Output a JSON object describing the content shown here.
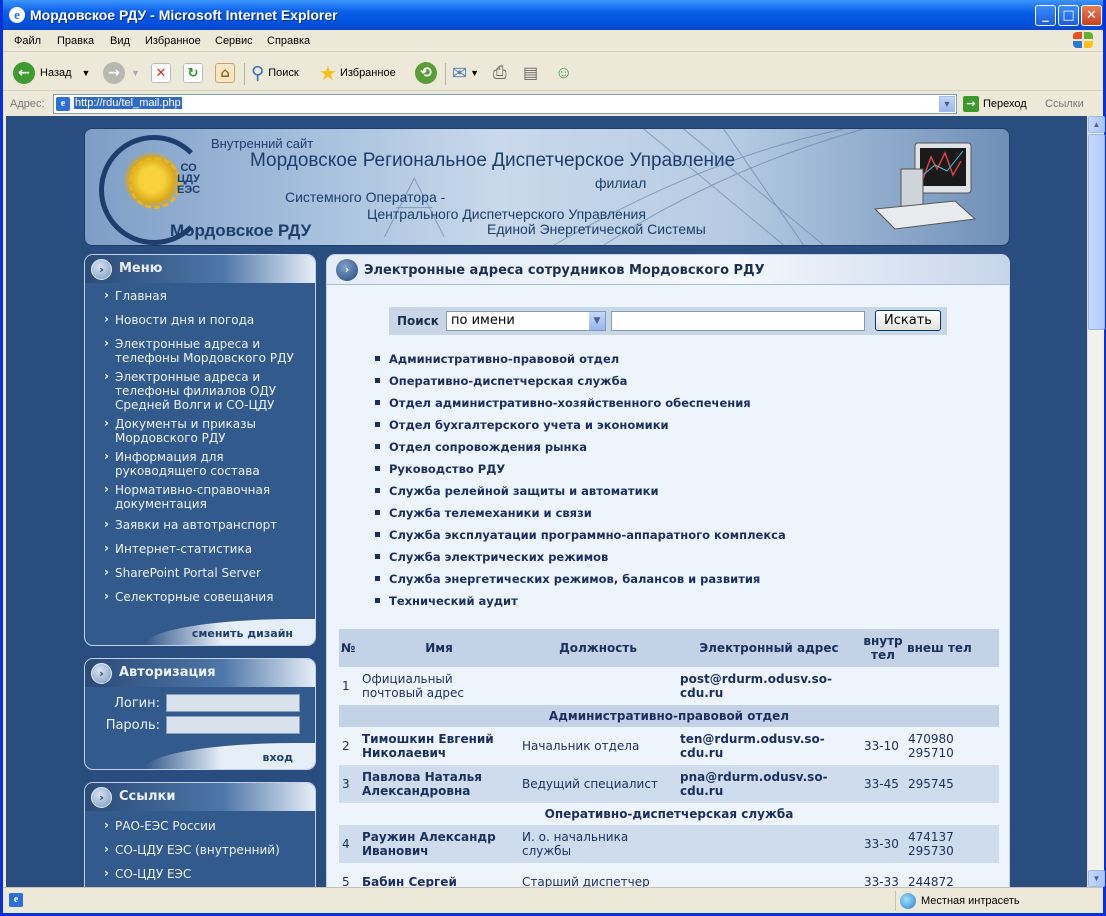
{
  "window": {
    "title": "Мордовское РДУ - Microsoft Internet Explorer"
  },
  "menu": [
    "Файл",
    "Правка",
    "Вид",
    "Избранное",
    "Сервис",
    "Справка"
  ],
  "toolbar": {
    "back": "Назад",
    "search": "Поиск",
    "favorites": "Избранное"
  },
  "address": {
    "label": "Адрес:",
    "url": "http://rdu/tel_mail.php",
    "go": "Переход",
    "links": "Ссылки"
  },
  "status": {
    "zone": "Местная интрасеть"
  },
  "banner": {
    "internal": "Внутренний сайт",
    "org": "Мордовское Региональное Диспетчерское Управление",
    "branch": "филиал",
    "line1": "Системного Оператора -",
    "line2": "Центрального Диспетчерского Управления",
    "line3": "Единой Энергетической Системы",
    "short": "Мордовское РДУ",
    "logo_text": [
      "СО",
      "ЦДУ",
      "ЕЭС"
    ]
  },
  "sidebar": {
    "menu_title": "Меню",
    "menu_items": [
      "Главная",
      "Новости дня и погода",
      "Электронные адреса и телефоны Мордовского РДУ",
      "Электронные адреса и телефоны филиалов ОДУ Средней Волги и СО-ЦДУ",
      "Документы и приказы Мордовского РДУ",
      "Информация для руководящего состава",
      "Нормативно-справочная документация",
      "Заявки на автотранспорт",
      "Интернет-статистика",
      "SharePoint Portal Server",
      "Селекторные совещания"
    ],
    "change_design": "сменить дизайн",
    "auth_title": "Авторизация",
    "login_label": "Логин:",
    "password_label": "Пароль:",
    "login_link": "вход",
    "links_title": "Ссылки",
    "links": [
      "РАО-ЕЭС России",
      "СО-ЦДУ ЕЭС (внутренний)",
      "СО-ЦДУ ЕЭС"
    ]
  },
  "content": {
    "title": "Электронные адреса сотрудников Мордовского РДУ",
    "search_label": "Поиск",
    "search_mode": "по имени",
    "search_button": "Искать",
    "departments": [
      "Административно-правовой отдел",
      "Оперативно-диспетчерская служба",
      "Отдел административно-хозяйственного обеспечения",
      "Отдел бухгалтерского учета и экономики",
      "Отдел сопровождения рынка",
      "Руководство РДУ",
      "Служба релейной защиты и автоматики",
      "Служба телемеханики и связи",
      "Служба эксплуатации программно-аппаратного комплекса",
      "Служба электрических режимов",
      "Служба энергетических режимов, балансов и развития",
      "Технический аудит"
    ],
    "table": {
      "headers": [
        "№",
        "Имя",
        "Должность",
        "Электронный адрес",
        "внутр тел",
        "внеш тел"
      ],
      "row1": {
        "n": "1",
        "name": "Официальный почтовый адрес",
        "pos": "",
        "email": "post@rdurm.odusv.so-cdu.ru",
        "in": "",
        "out": ""
      },
      "group1": "Административно-правовой отдел",
      "row2": {
        "n": "2",
        "name": "Тимошкин Евгений Николаевич",
        "pos": "Начальник отдела",
        "email": "ten@rdurm.odusv.so-cdu.ru",
        "in": "33-10",
        "out1": "470980",
        "out2": "295710"
      },
      "row3": {
        "n": "3",
        "name": "Павлова Наталья Александровна",
        "pos": "Ведущий специалист",
        "email": "pna@rdurm.odusv.so-cdu.ru",
        "in": "33-45",
        "out": "295745"
      },
      "group2": "Оперативно-диспетчерская служба",
      "row4": {
        "n": "4",
        "name": "Раужин Александр Иванович",
        "pos": "И. о. начальника службы",
        "email": "",
        "in": "33-30",
        "out1": "474137",
        "out2": "295730"
      },
      "row5": {
        "n": "5",
        "name": "Бабин Сергей",
        "pos": "Старший диспетчер",
        "email": "",
        "in": "33-33",
        "out": "244872"
      }
    }
  }
}
